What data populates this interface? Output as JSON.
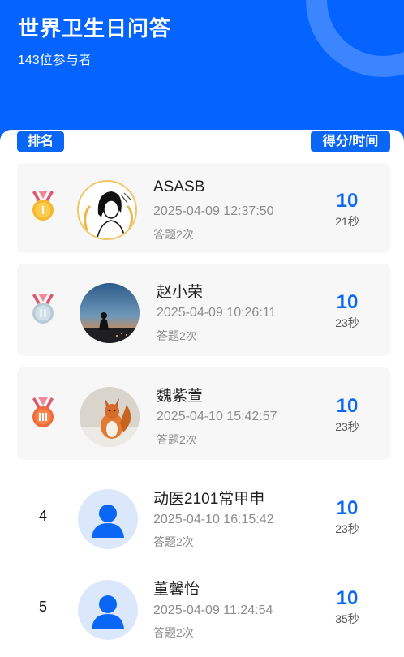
{
  "header": {
    "title": "世界卫生日问答",
    "participants": "143位参与者"
  },
  "labels": {
    "rank": "排名",
    "score_time": "得分/时间"
  },
  "entries": [
    {
      "rank": "1",
      "medal": "gold-medal-icon",
      "name": "ASASB",
      "datetime": "2025-04-09 12:37:50",
      "attempts": "答题2次",
      "score": "10",
      "duration": "21秒"
    },
    {
      "rank": "2",
      "medal": "silver-medal-icon",
      "name": "赵小荣",
      "datetime": "2025-04-09 10:26:11",
      "attempts": "答题2次",
      "score": "10",
      "duration": "23秒"
    },
    {
      "rank": "3",
      "medal": "bronze-medal-icon",
      "name": "魏紫萱",
      "datetime": "2025-04-10 15:42:57",
      "attempts": "答题2次",
      "score": "10",
      "duration": "23秒"
    },
    {
      "rank": "4",
      "name": "动医2101常甲申",
      "datetime": "2025-04-10 16:15:42",
      "attempts": "答题2次",
      "score": "10",
      "duration": "23秒"
    },
    {
      "rank": "5",
      "name": "董馨怡",
      "datetime": "2025-04-09 11:24:54",
      "attempts": "答题2次",
      "score": "10",
      "duration": "35秒"
    }
  ],
  "colors": {
    "brand_blue": "#0563ff",
    "accent_blue": "#0a66f5",
    "gold": "#f5b82e",
    "silver": "#b9ccd6",
    "bronze": "#f06a3a"
  }
}
